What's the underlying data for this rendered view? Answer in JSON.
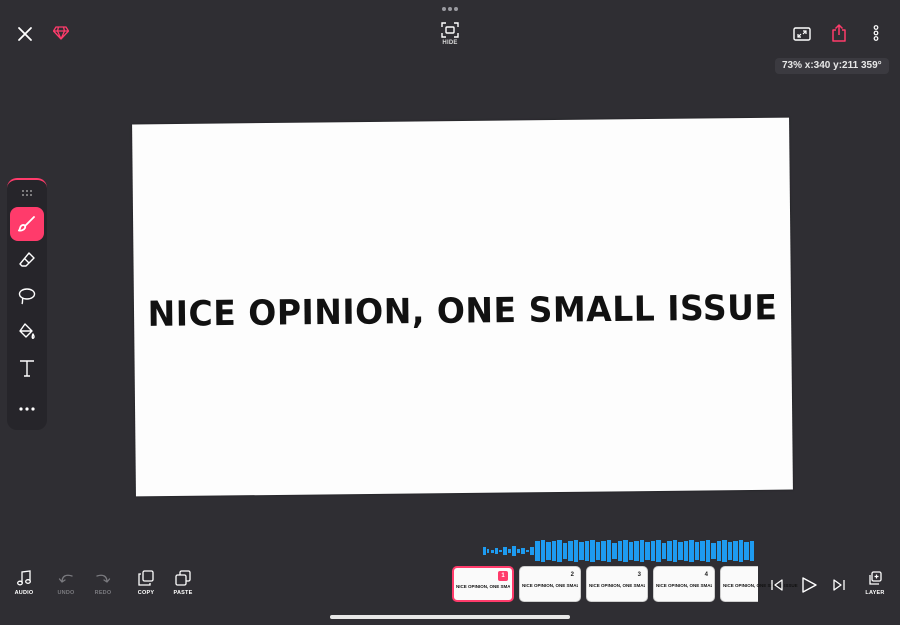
{
  "header": {
    "hide_label": "HIDE",
    "transform_readout": "73% x:340 y:211 359°"
  },
  "canvas": {
    "text": "NICE OPINION, ONE SMALL ISSUE"
  },
  "bottom_toolbar": {
    "audio_label": "AUDIO",
    "undo_label": "UNDO",
    "redo_label": "REDO",
    "copy_label": "COPY",
    "paste_label": "PASTE",
    "layer_label": "LAYER"
  },
  "frames": [
    {
      "number": "1",
      "text": "NICE OPINION, ONE SMALL ISSUE",
      "active": true
    },
    {
      "number": "2",
      "text": "NICE OPINION, ONE SMALL ISSUE",
      "active": false
    },
    {
      "number": "3",
      "text": "NICE OPINION, ONE SMALL ISSUE",
      "active": false
    },
    {
      "number": "4",
      "text": "NICE OPINION, ONE SMALL ISSUE",
      "active": false
    },
    {
      "number": "",
      "text": "NICE OPINION, ONE SMALL ISSUE",
      "active": false
    }
  ],
  "colors": {
    "background": "#2f2e33",
    "accent": "#ff3b6b",
    "waveform": "#1e9bf0"
  },
  "icons": [
    "close-icon",
    "diamond-icon",
    "more-dots-icon",
    "hide-icon",
    "fit-screen-icon",
    "share-icon",
    "kebab-menu-icon",
    "drag-handle-icon",
    "brush-icon",
    "eraser-icon",
    "lasso-icon",
    "paint-bucket-icon",
    "text-tool-icon",
    "more-tools-icon",
    "music-note-icon",
    "undo-icon",
    "redo-icon",
    "copy-icon",
    "paste-icon",
    "skip-back-icon",
    "play-icon",
    "skip-forward-icon",
    "layers-icon"
  ]
}
